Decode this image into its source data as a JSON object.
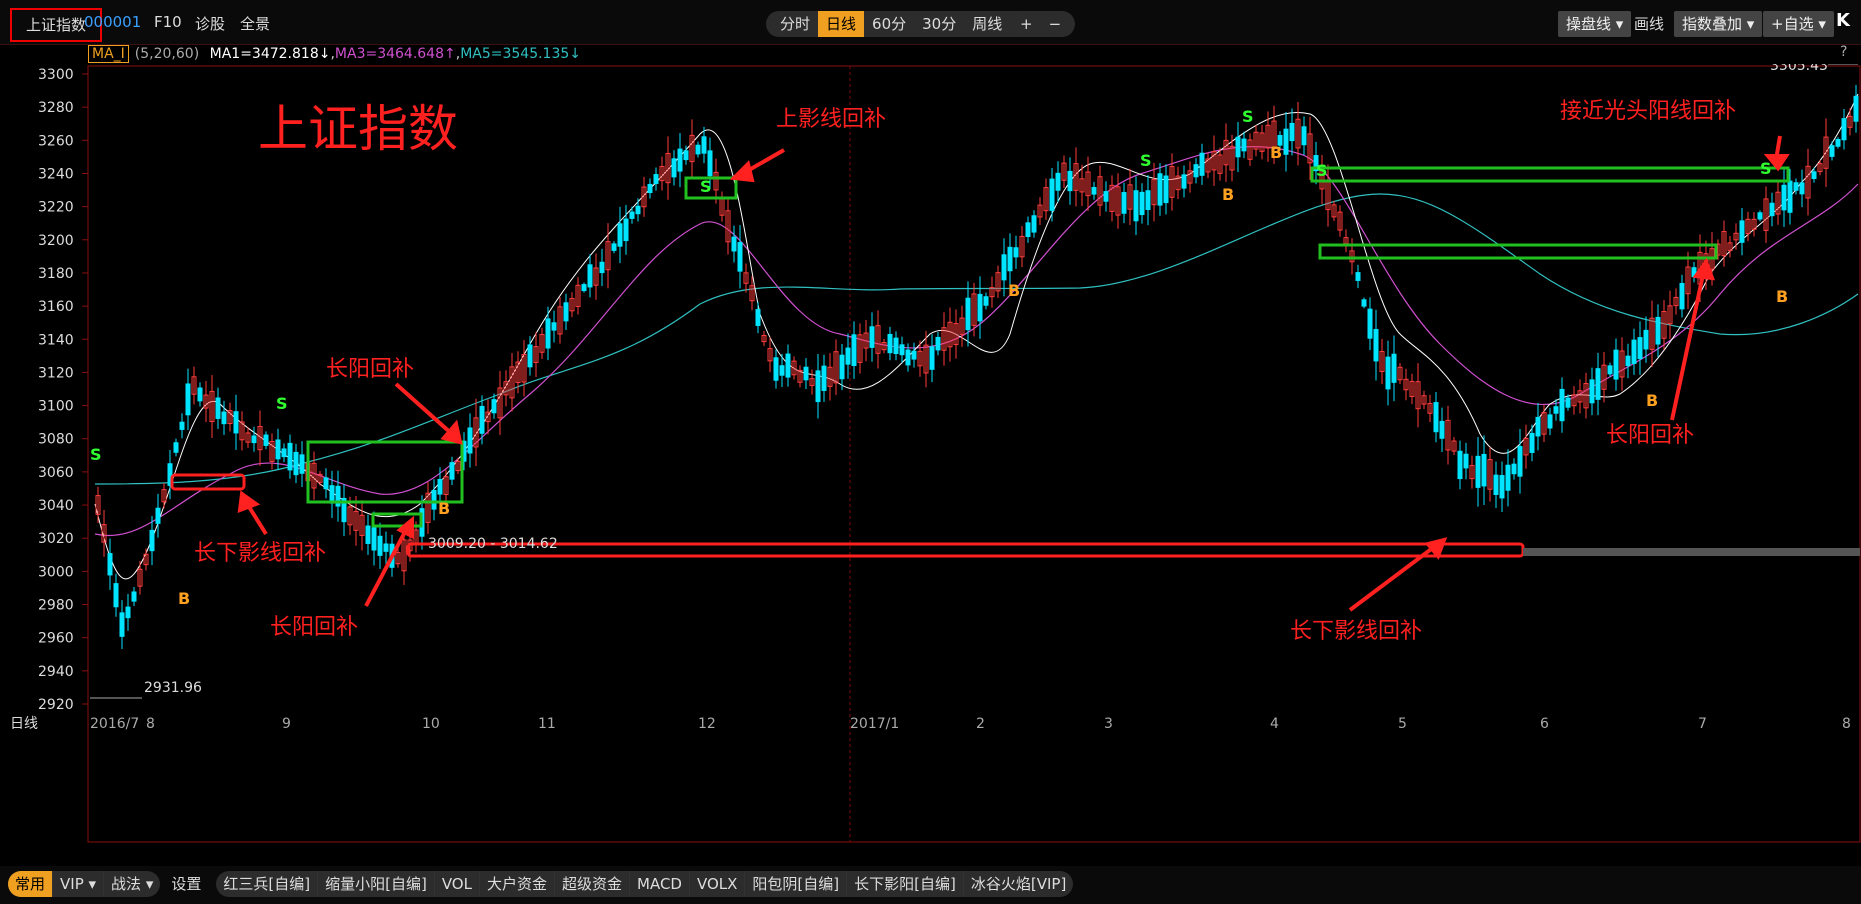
{
  "header": {
    "index_name": "上证指数",
    "code": "000001",
    "links": [
      "F10",
      "诊股",
      "全景"
    ],
    "periods": [
      "分时",
      "日线",
      "60分",
      "30分",
      "周线 ▾"
    ],
    "active_period": "日线",
    "zoom": [
      "+",
      "−"
    ],
    "right_buttons": [
      "操盘线 ▾",
      "画线",
      "指数叠加 ▾",
      "+自选 ▾"
    ],
    "k_label": "K",
    "help": "?"
  },
  "ma": {
    "tag": "MA_I",
    "params": "(5,20,60)",
    "ma1": "MA1=3472.818↓",
    "ma3": "MA3=3464.648↑",
    "ma5": "MA5=3545.135↓"
  },
  "chart": {
    "title": "上证指数",
    "y_ticks": [
      "3300",
      "3280",
      "3260",
      "3240",
      "3220",
      "3200",
      "3180",
      "3160",
      "3140",
      "3120",
      "3100",
      "3080",
      "3060",
      "3040",
      "3020",
      "3000",
      "2980",
      "2960",
      "2940",
      "2920"
    ],
    "x_labels": [
      "2016/7",
      "8",
      "9",
      "10",
      "11",
      "12",
      "2017/1",
      "2",
      "3",
      "4",
      "5",
      "6",
      "7",
      "8"
    ],
    "period_label": "日线",
    "high_label": "3305.43",
    "low_label": "2931.96",
    "range_label": "3009.20 - 3014.62",
    "annotations": [
      "上影线回补",
      "接近光头阳线回补",
      "长阳回补",
      "长下影线回补",
      "长阳回补",
      "长阳回补",
      "长下影线回补"
    ],
    "signals": [
      "S",
      "S",
      "S",
      "S",
      "S",
      "S",
      "S",
      "B",
      "B",
      "B",
      "B",
      "B",
      "B",
      "B"
    ],
    "colors": {
      "up": "#ff3c3c",
      "down": "#00e5ff",
      "ma1": "#ffffff",
      "ma3": "#d050d0",
      "ma5": "#30c0c0",
      "box_green": "#20c020",
      "box_red": "#ff2020",
      "signal_s": "#30ff30",
      "signal_b": "#ffa020"
    }
  },
  "bottom": {
    "tab_first": "常用",
    "tab_vip": "VIP ▾",
    "tab_zhan": "战法 ▾",
    "tab_settings": "设置",
    "indicators": [
      "红三兵[自编]",
      "缩量小阳[自编]",
      "VOL",
      "大户资金",
      "超级资金",
      "MACD",
      "VOLX",
      "阳包阴[自编]",
      "长下影阳[自编]",
      "冰谷火焰[VIP]"
    ]
  }
}
